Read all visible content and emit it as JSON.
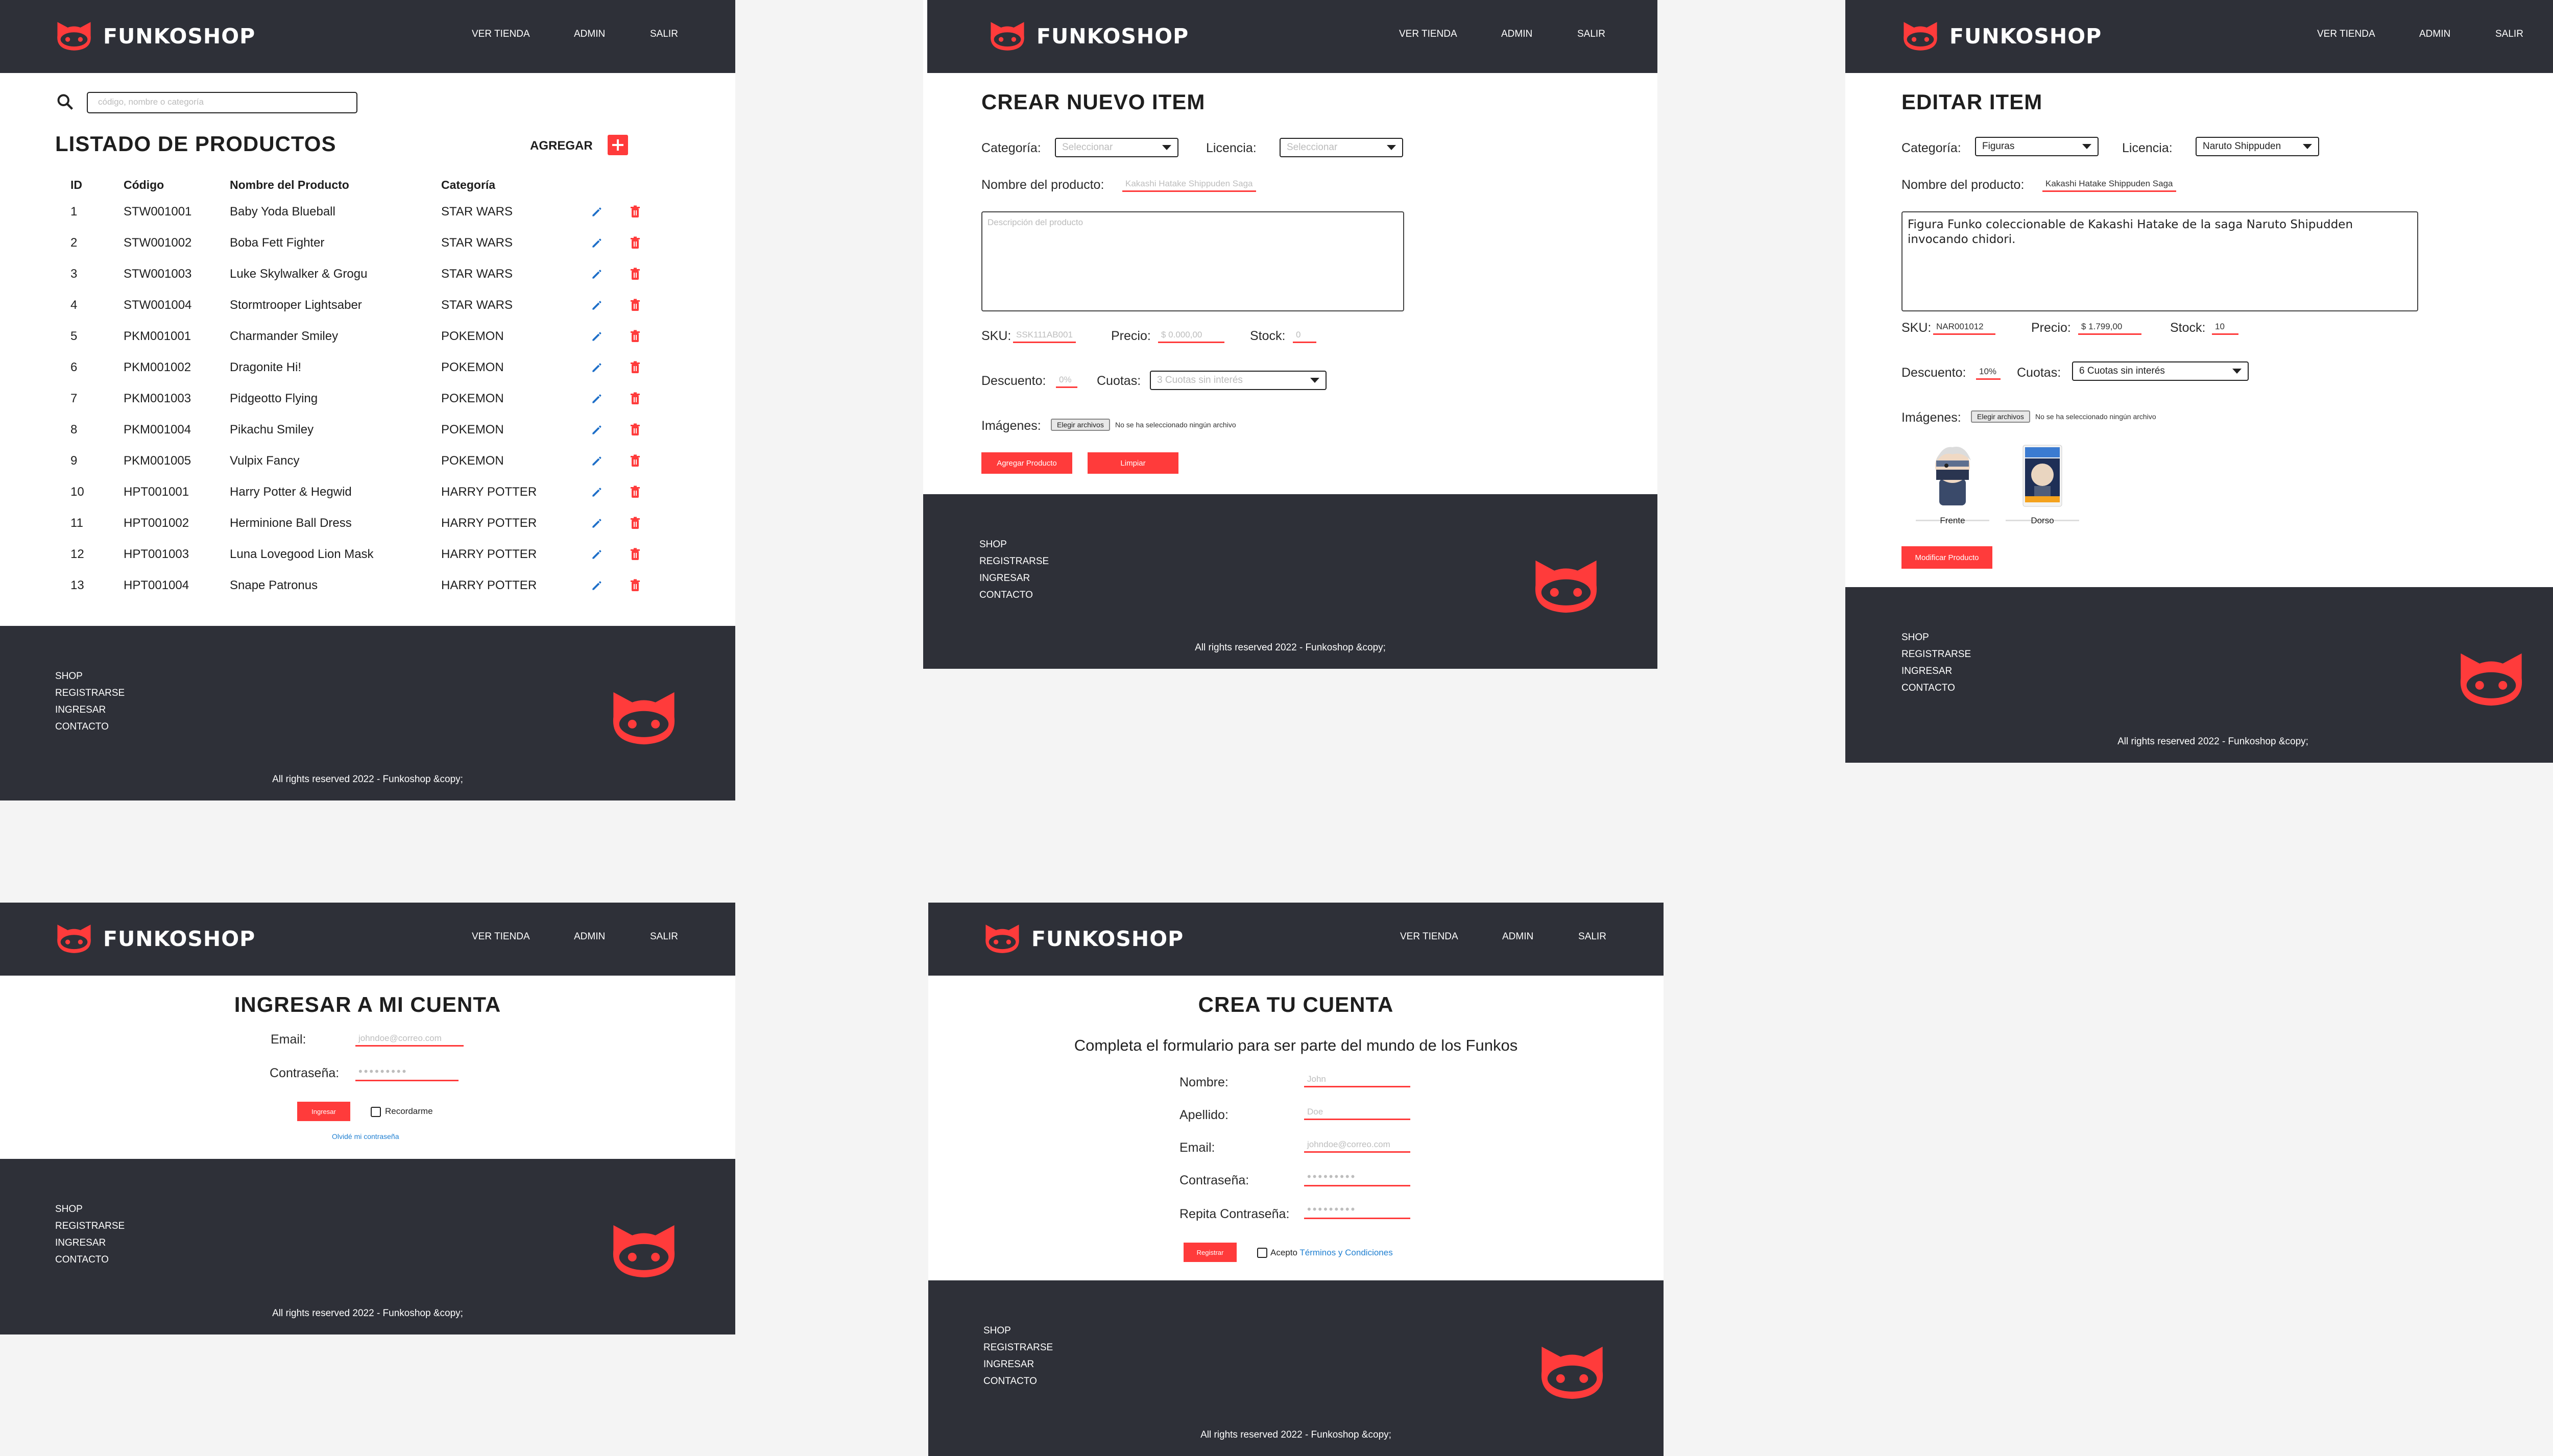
{
  "brand": {
    "name": "FUNKOSHOP",
    "accent": "#ff3b3b",
    "dark": "#2e3038"
  },
  "nav": {
    "store": "VER TIENDA",
    "admin": "ADMIN",
    "logout": "SALIR"
  },
  "footer": {
    "links": [
      "SHOP",
      "REGISTRARSE",
      "INGRESAR",
      "CONTACTO"
    ],
    "copyright": "All rights reserved 2022 - Funkoshop &copy;"
  },
  "list": {
    "search_placeholder": "código, nombre o categoría",
    "title": "LISTADO DE PRODUCTOS",
    "add_label": "AGREGAR",
    "columns": [
      "ID",
      "Código",
      "Nombre del Producto",
      "Categoría"
    ],
    "rows": [
      {
        "id": "1",
        "code": "STW001001",
        "name": "Baby Yoda Blueball",
        "cat": "STAR WARS"
      },
      {
        "id": "2",
        "code": "STW001002",
        "name": "Boba Fett Fighter",
        "cat": "STAR WARS"
      },
      {
        "id": "3",
        "code": "STW001003",
        "name": "Luke Skylwalker & Grogu",
        "cat": "STAR WARS"
      },
      {
        "id": "4",
        "code": "STW001004",
        "name": "Stormtrooper Lightsaber",
        "cat": "STAR WARS"
      },
      {
        "id": "5",
        "code": "PKM001001",
        "name": "Charmander Smiley",
        "cat": "POKEMON"
      },
      {
        "id": "6",
        "code": "PKM001002",
        "name": "Dragonite Hi!",
        "cat": "POKEMON"
      },
      {
        "id": "7",
        "code": "PKM001003",
        "name": "Pidgeotto Flying",
        "cat": "POKEMON"
      },
      {
        "id": "8",
        "code": "PKM001004",
        "name": "Pikachu Smiley",
        "cat": "POKEMON"
      },
      {
        "id": "9",
        "code": "PKM001005",
        "name": "Vulpix Fancy",
        "cat": "POKEMON"
      },
      {
        "id": "10",
        "code": "HPT001001",
        "name": "Harry Potter & Hegwid",
        "cat": "HARRY POTTER"
      },
      {
        "id": "11",
        "code": "HPT001002",
        "name": "Herminione Ball Dress",
        "cat": "HARRY POTTER"
      },
      {
        "id": "12",
        "code": "HPT001003",
        "name": "Luna Lovegood Lion Mask",
        "cat": "HARRY POTTER"
      },
      {
        "id": "13",
        "code": "HPT001004",
        "name": "Snape Patronus",
        "cat": "HARRY POTTER"
      }
    ]
  },
  "create": {
    "title": "CREAR NUEVO ITEM",
    "category_label": "Categoría:",
    "category_value": "Seleccionar",
    "license_label": "Licencia:",
    "license_value": "Seleccionar",
    "name_label": "Nombre del producto:",
    "name_placeholder": "Kakashi Hatake Shippuden Saga",
    "desc_placeholder": "Descripción del producto",
    "sku_label": "SKU:",
    "sku_placeholder": "SSK111AB001",
    "price_label": "Precio:",
    "price_placeholder": "$ 0.000,00",
    "stock_label": "Stock:",
    "stock_placeholder": "0",
    "discount_label": "Descuento:",
    "discount_placeholder": "0%",
    "installments_label": "Cuotas:",
    "installments_value": "3 Cuotas sin interés",
    "images_label": "Imágenes:",
    "file_button": "Elegir archivos",
    "file_text": "No se ha seleccionado ningún archivo",
    "submit": "Agregar Producto",
    "clear": "Limpiar"
  },
  "edit": {
    "title": "EDITAR ITEM",
    "category_label": "Categoría:",
    "category_value": "Figuras",
    "license_label": "Licencia:",
    "license_value": "Naruto Shippuden",
    "name_label": "Nombre del producto:",
    "name_value": "Kakashi Hatake Shippuden Saga",
    "desc_value": "Figura Funko coleccionable de Kakashi Hatake de la saga Naruto Shipudden invocando chidori.",
    "sku_label": "SKU:",
    "sku_value": "NAR001012",
    "price_label": "Precio:",
    "price_value": "$ 1.799,00",
    "stock_label": "Stock:",
    "stock_value": "10",
    "discount_label": "Descuento:",
    "discount_value": "10%",
    "installments_label": "Cuotas:",
    "installments_value": "6 Cuotas sin interés",
    "images_label": "Imágenes:",
    "file_button": "Elegir archivos",
    "file_text": "No se ha seleccionado ningún archivo",
    "image_front": "Frente",
    "image_back": "Dorso",
    "submit": "Modificar Producto"
  },
  "login": {
    "title": "INGRESAR A MI CUENTA",
    "email_label": "Email:",
    "email_placeholder": "johndoe@correo.com",
    "password_label": "Contraseña:",
    "password_placeholder": "•••••••••",
    "submit": "Ingresar",
    "remember": "Recordarme",
    "forgot": "Olvidé mi contraseña"
  },
  "register": {
    "title": "CREA TU CUENTA",
    "subtitle": "Completa el formulario para ser parte del mundo de los Funkos",
    "name_label": "Nombre:",
    "name_placeholder": "John",
    "lastname_label": "Apellido:",
    "lastname_placeholder": "Doe",
    "email_label": "Email:",
    "email_placeholder": "johndoe@correo.com",
    "password_label": "Contraseña:",
    "password_placeholder": "•••••••••",
    "repeat_label": "Repita Contraseña:",
    "repeat_placeholder": "•••••••••",
    "submit": "Registrar",
    "accept": "Acepto",
    "terms": "Términos y Condiciones"
  }
}
